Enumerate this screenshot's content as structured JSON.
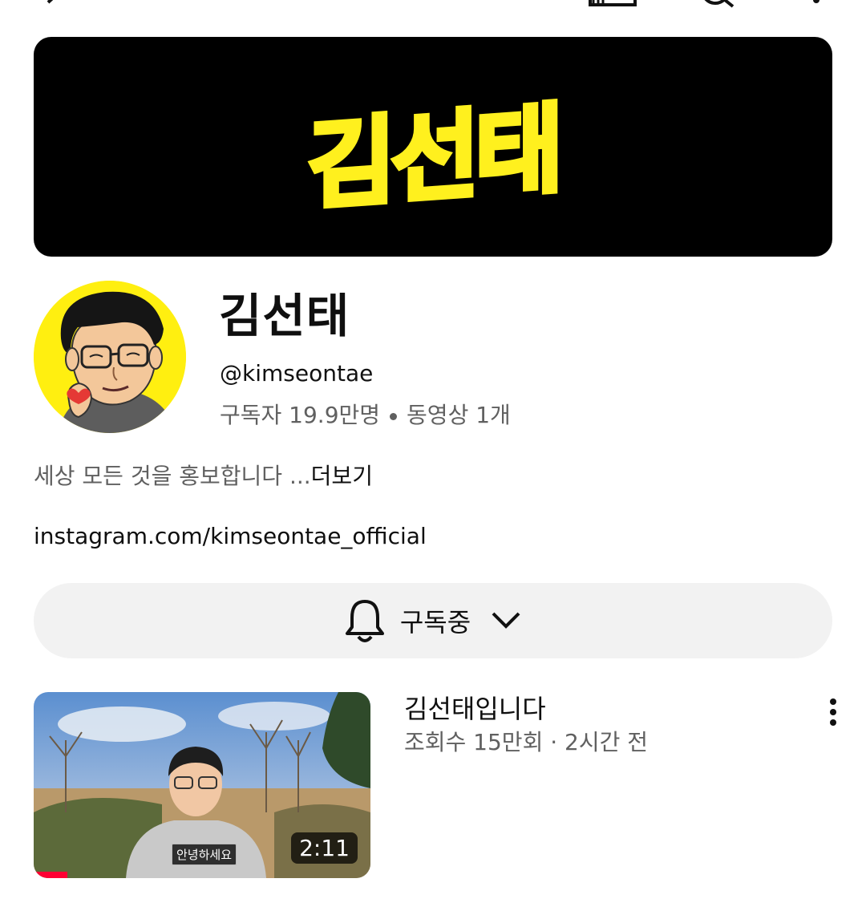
{
  "topbar": {
    "icons": [
      "back-icon",
      "cast-icon",
      "search-icon",
      "more-vert-icon"
    ]
  },
  "banner": {
    "text": "김선태",
    "bg": "#000000",
    "text_color": "#fff01e"
  },
  "channel": {
    "name": "김선태",
    "handle": "@kimseontae",
    "subscribers": "구독자 19.9만명",
    "videos": "동영상 1개",
    "description": "세상 모든 것을 홍보합니다 ...",
    "more_label": "더보기",
    "link": "instagram.com/kimseontae_official"
  },
  "subscribe": {
    "label": "구독중",
    "icon": "bell-icon",
    "chevron": "chevron-down-icon"
  },
  "video": {
    "title": "김선태입니다",
    "meta": "조회수 15만회 · 2시간 전",
    "duration": "2:11",
    "caption": "안녕하세요",
    "progress": 0.1,
    "progress_color": "#ff0033"
  }
}
